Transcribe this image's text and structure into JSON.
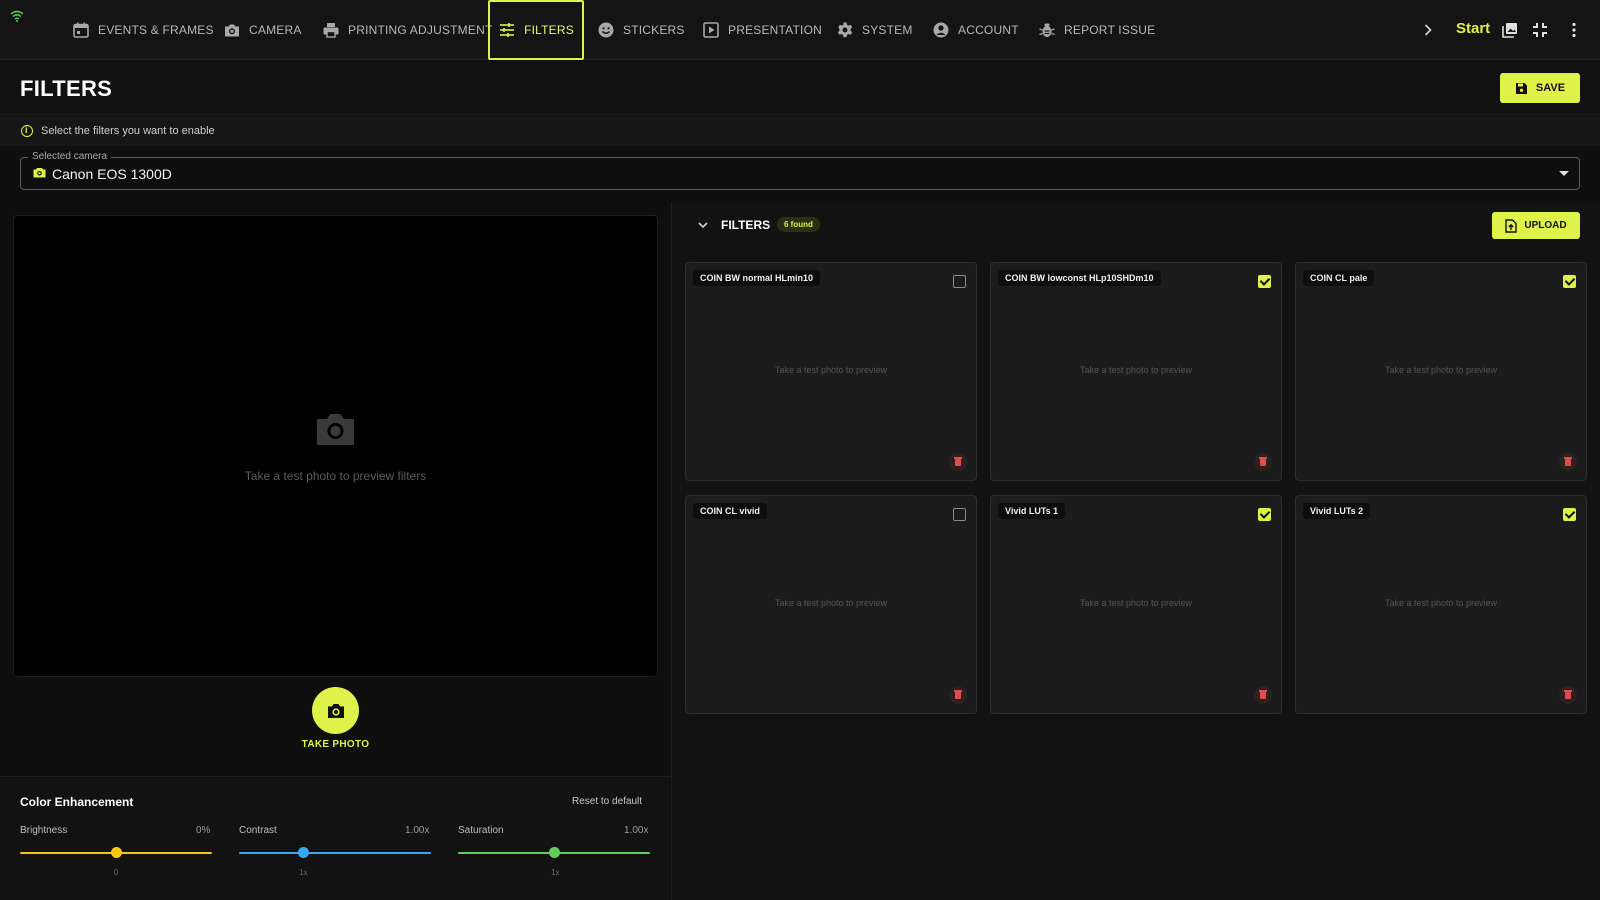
{
  "nav": {
    "tabs": [
      {
        "label": "EVENTS & FRAMES",
        "icon": "calendar-icon"
      },
      {
        "label": "CAMERA",
        "icon": "camera-icon"
      },
      {
        "label": "PRINTING ADJUSTMENT",
        "icon": "printer-icon"
      },
      {
        "label": "FILTERS",
        "icon": "sliders-icon",
        "active": true
      },
      {
        "label": "STICKERS",
        "icon": "smiley-icon"
      },
      {
        "label": "PRESENTATION",
        "icon": "presentation-icon"
      },
      {
        "label": "SYSTEM",
        "icon": "gear-icon"
      },
      {
        "label": "ACCOUNT",
        "icon": "account-icon"
      },
      {
        "label": "REPORT ISSUE",
        "icon": "bug-icon"
      }
    ],
    "start_label": "Start"
  },
  "page": {
    "title": "FILTERS",
    "save_label": "SAVE",
    "info_text": "Select the filters you want to enable"
  },
  "camera": {
    "legend": "Selected camera",
    "value": "Canon EOS 1300D"
  },
  "preview": {
    "placeholder": "Take a test photo to preview filters",
    "take_photo_label": "TAKE PHOTO"
  },
  "color_enhancement": {
    "title": "Color Enhancement",
    "reset_label": "Reset to default",
    "sliders": [
      {
        "label": "Brightness",
        "value": "0%",
        "tick": "0",
        "level": 0.5,
        "color": "#f5c518"
      },
      {
        "label": "Contrast",
        "value": "1.00x",
        "tick": "1x",
        "level": 0.33,
        "color": "#3aa8f0"
      },
      {
        "label": "Saturation",
        "value": "1.00x",
        "tick": "1x",
        "level": 0.5,
        "color": "#5fce5f"
      }
    ]
  },
  "filters": {
    "title": "FILTERS",
    "count_badge": "6 found",
    "upload_label": "UPLOAD",
    "preview_placeholder": "Take a test photo to preview",
    "items": [
      {
        "name": "COIN BW normal HLmin10",
        "enabled": false
      },
      {
        "name": "COIN BW lowconst HLp10SHDm10",
        "enabled": true
      },
      {
        "name": "COIN CL pale",
        "enabled": true
      },
      {
        "name": "COIN CL vivid",
        "enabled": false
      },
      {
        "name": "Vivid LUTs 1",
        "enabled": true
      },
      {
        "name": "Vivid LUTs 2",
        "enabled": true
      }
    ]
  },
  "colors": {
    "accent": "#dff24a",
    "background": "#0f0f0f",
    "danger": "#e14b4b"
  }
}
